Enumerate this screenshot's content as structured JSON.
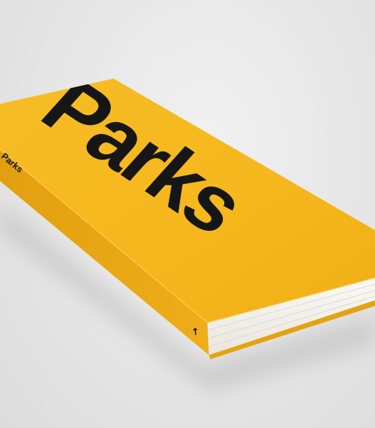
{
  "book": {
    "cover_title": "Parks",
    "spine_title": "Parks",
    "spine_logo_glyph": "↖"
  },
  "colors": {
    "background": "#e6e6e6",
    "cover_yellow": "#f5b71c",
    "spine_yellow": "#eaa914",
    "page_edge": "#f4f2ec",
    "ink": "#161616"
  }
}
